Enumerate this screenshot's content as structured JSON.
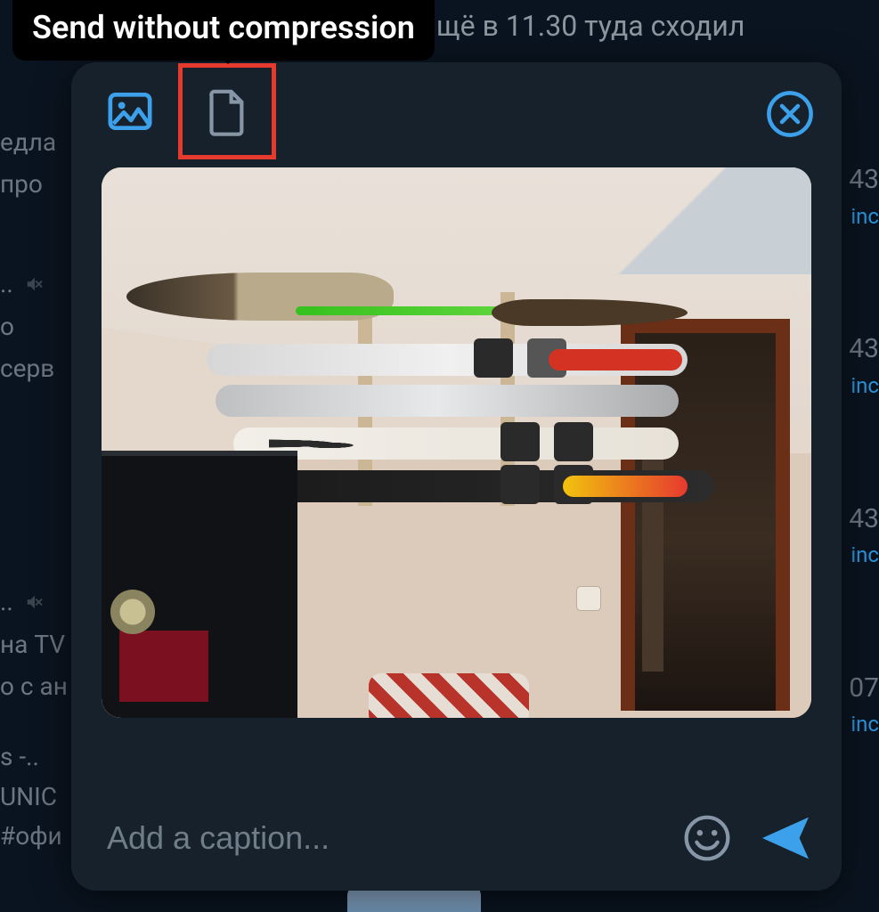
{
  "tooltip": {
    "text": "Send without compression"
  },
  "background_chat": {
    "top_line": "щё в 11.30 туда сходил",
    "left_fragments": [
      "едла",
      "про",
      ".. ",
      "о",
      "серв",
      ".. ",
      "на TV",
      "о с ан"
    ],
    "right_fragments": [
      {
        "time": "43",
        "status": "inc"
      },
      {
        "time": "43",
        "status": "inc"
      },
      {
        "time": "43",
        "status": "inc"
      },
      {
        "time": "07",
        "status": "inc"
      }
    ],
    "bottom_left": [
      "s -..",
      "UNIC",
      "#офи"
    ]
  },
  "modal": {
    "header": {
      "photo_mode_icon": "photo-icon",
      "file_mode_icon": "document-icon",
      "close_icon": "close-icon"
    },
    "caption": {
      "placeholder": "Add a caption...",
      "value": ""
    },
    "buttons": {
      "emoji_icon": "smile-icon",
      "send_icon": "send-icon"
    }
  },
  "colors": {
    "accent": "#3ca1ea",
    "highlight_box": "#e63a2e",
    "modal_bg": "#17212b",
    "page_bg": "#0a1420"
  }
}
